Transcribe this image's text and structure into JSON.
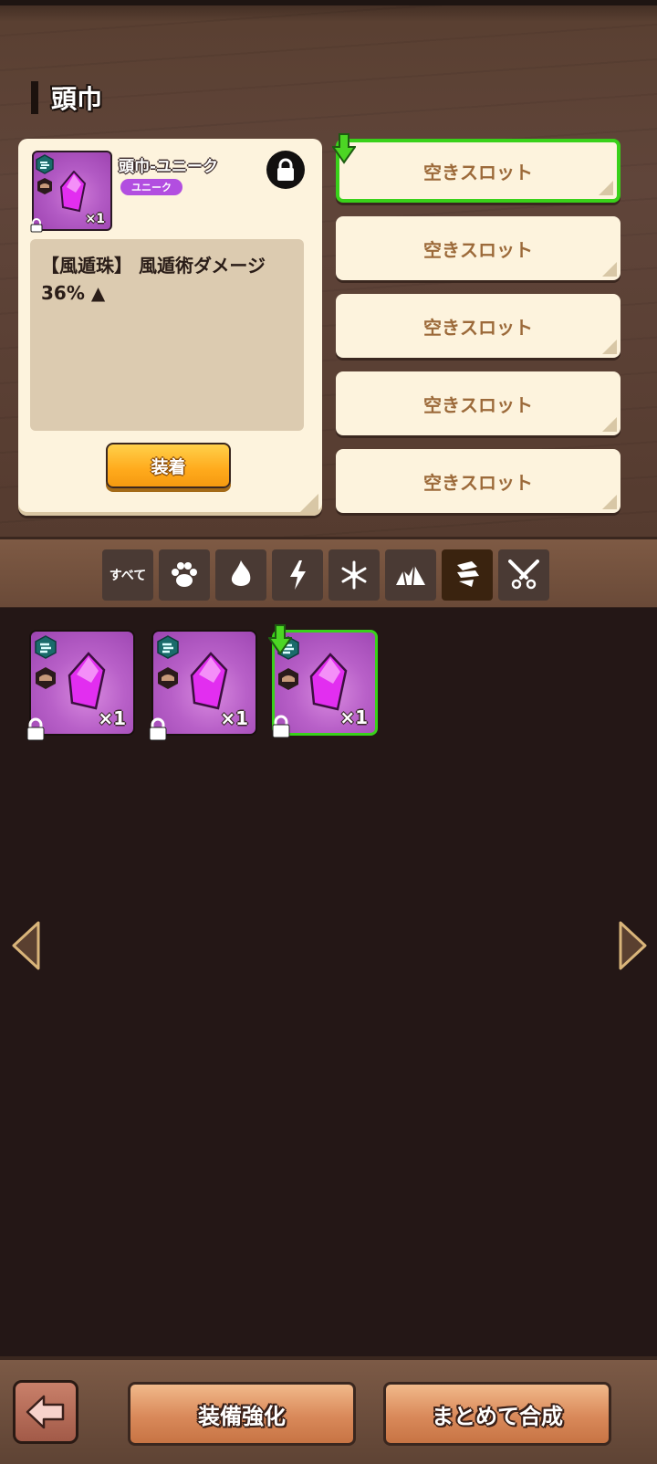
{
  "header": {
    "title": "頭巾"
  },
  "detail": {
    "item_name": "頭巾-ユニーク",
    "rarity": "ユニーク",
    "quantity": "×1",
    "description": "【風遁珠】 風遁術ダメージ 36% ▲",
    "equip_label": "装着",
    "locked": true
  },
  "slots": [
    {
      "label": "空きスロット",
      "selected": true
    },
    {
      "label": "空きスロット",
      "selected": false
    },
    {
      "label": "空きスロット",
      "selected": false
    },
    {
      "label": "空きスロット",
      "selected": false
    },
    {
      "label": "空きスロット",
      "selected": false
    }
  ],
  "tabs": [
    {
      "label": "すべて",
      "icon": "all"
    },
    {
      "icon": "paw-icon"
    },
    {
      "icon": "fire-icon"
    },
    {
      "icon": "lightning-icon"
    },
    {
      "icon": "snowflake-icon"
    },
    {
      "icon": "rock-icon"
    },
    {
      "icon": "wind-icon",
      "active": true
    },
    {
      "icon": "crossed-kunai-icon"
    }
  ],
  "inventory": [
    {
      "quantity": "×1",
      "locked": true,
      "selected": false
    },
    {
      "quantity": "×1",
      "locked": true,
      "selected": false
    },
    {
      "quantity": "×1",
      "locked": true,
      "selected": true
    }
  ],
  "footer": {
    "enhance_label": "装備強化",
    "bulk_synthesize_label": "まとめて合成"
  },
  "colors": {
    "accent_green": "#39d11a",
    "equip_orange": "#ffaa1c",
    "rarity_purple": "#b24ee0"
  }
}
